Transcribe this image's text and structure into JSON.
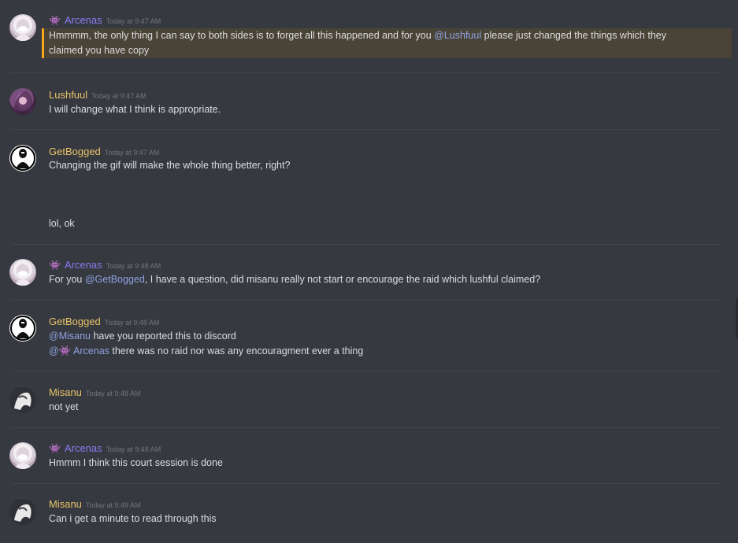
{
  "messages": [
    {
      "avatar_icon": "arcenas-avatar",
      "badge_icon": "skull-emoji-icon",
      "author": "Arcenas",
      "timestamp": "Today at 9:47 AM",
      "lines": [
        {
          "pre": "Hmmmm, the only thing I can say to both sides is to forget all this happened and for you ",
          "mention": "@Lushfuul",
          "post": " please just changed the things which they"
        },
        {
          "pre": "claimed you have copy"
        }
      ]
    },
    {
      "avatar_icon": "lushfuul-avatar",
      "author": "Lushfuul",
      "timestamp": "Today at 9:47 AM",
      "lines": [
        {
          "pre": "I will change what I think is appropriate."
        }
      ]
    },
    {
      "avatar_icon": "getbogged-avatar",
      "author": "GetBogged",
      "timestamp": "Today at 9:47 AM",
      "lines": [
        {
          "pre": "Changing the gif will make the whole thing better, right?"
        },
        {
          "pre": "lol, ok"
        }
      ]
    },
    {
      "avatar_icon": "arcenas-avatar",
      "badge_icon": "skull-emoji-icon",
      "author": "Arcenas",
      "timestamp": "Today at 9:48 AM",
      "lines": [
        {
          "pre": "For you ",
          "mention": "@GetBogged",
          "post": ", I have a question, did misanu really not start or encourage the raid which lushful claimed?"
        }
      ]
    },
    {
      "avatar_icon": "getbogged-avatar",
      "author": "GetBogged",
      "timestamp": "Today at 9:48 AM",
      "lines": [
        {
          "mention": "@Misanu",
          "post": " have you reported this to discord"
        },
        {
          "mention": "@👾 Arcenas",
          "post": " there was no raid nor was any encouragment ever a thing"
        }
      ]
    },
    {
      "avatar_icon": "misanu-avatar",
      "author": "Misanu",
      "timestamp": "Today at 9:48 AM",
      "lines": [
        {
          "pre": "not yet"
        }
      ]
    },
    {
      "avatar_icon": "arcenas-avatar",
      "badge_icon": "skull-emoji-icon",
      "author": "Arcenas",
      "timestamp": "Today at 9:48 AM",
      "lines": [
        {
          "pre": "Hmmm I think this court session is done"
        }
      ]
    },
    {
      "avatar_icon": "misanu-avatar",
      "author": "Misanu",
      "timestamp": "Today at 9:49 AM",
      "lines": [
        {
          "pre": "Can i get a minute to read through this"
        }
      ]
    }
  ],
  "badge_glyph": "👾",
  "colors": {
    "background": "#36393f",
    "text": "#dcddde",
    "timestamp": "#72767d",
    "mention": "#8ea1e1",
    "name_purple": "#8b7af0",
    "name_gold": "#e9c46a",
    "highlight_bg": "#4a4438",
    "highlight_bar": "#faa61a"
  }
}
